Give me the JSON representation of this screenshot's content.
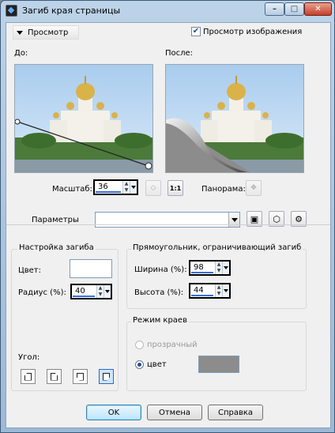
{
  "window": {
    "title": "Загиб края страницы"
  },
  "preview": {
    "toggle_label": "Просмотр",
    "show_image_label": "Просмотр изображения",
    "show_image_checked": true,
    "before_label": "До:",
    "after_label": "После:",
    "zoom_label": "Масштаб:",
    "zoom_value": "36",
    "pan_label": "Панорама:"
  },
  "params": {
    "label": "Параметры",
    "preset_value": ""
  },
  "curl_settings": {
    "title": "Настройка загиба",
    "color_label": "Цвет:",
    "color_value": "#ffffff",
    "radius_label": "Радиус (%):",
    "radius_value": "40",
    "angle_label": "Угол:"
  },
  "bounding_rect": {
    "title": "Прямоугольник, ограничивающий загиб",
    "width_label": "Ширина (%):",
    "width_value": "98",
    "height_label": "Высота (%):",
    "height_value": "44"
  },
  "edge_mode": {
    "title": "Режим краев",
    "transparent_label": "прозрачный",
    "color_label": "цвет",
    "selected": "color",
    "edge_color": "#8c8c8c"
  },
  "buttons": {
    "ok": "OK",
    "cancel": "Отмена",
    "help": "Справка"
  }
}
